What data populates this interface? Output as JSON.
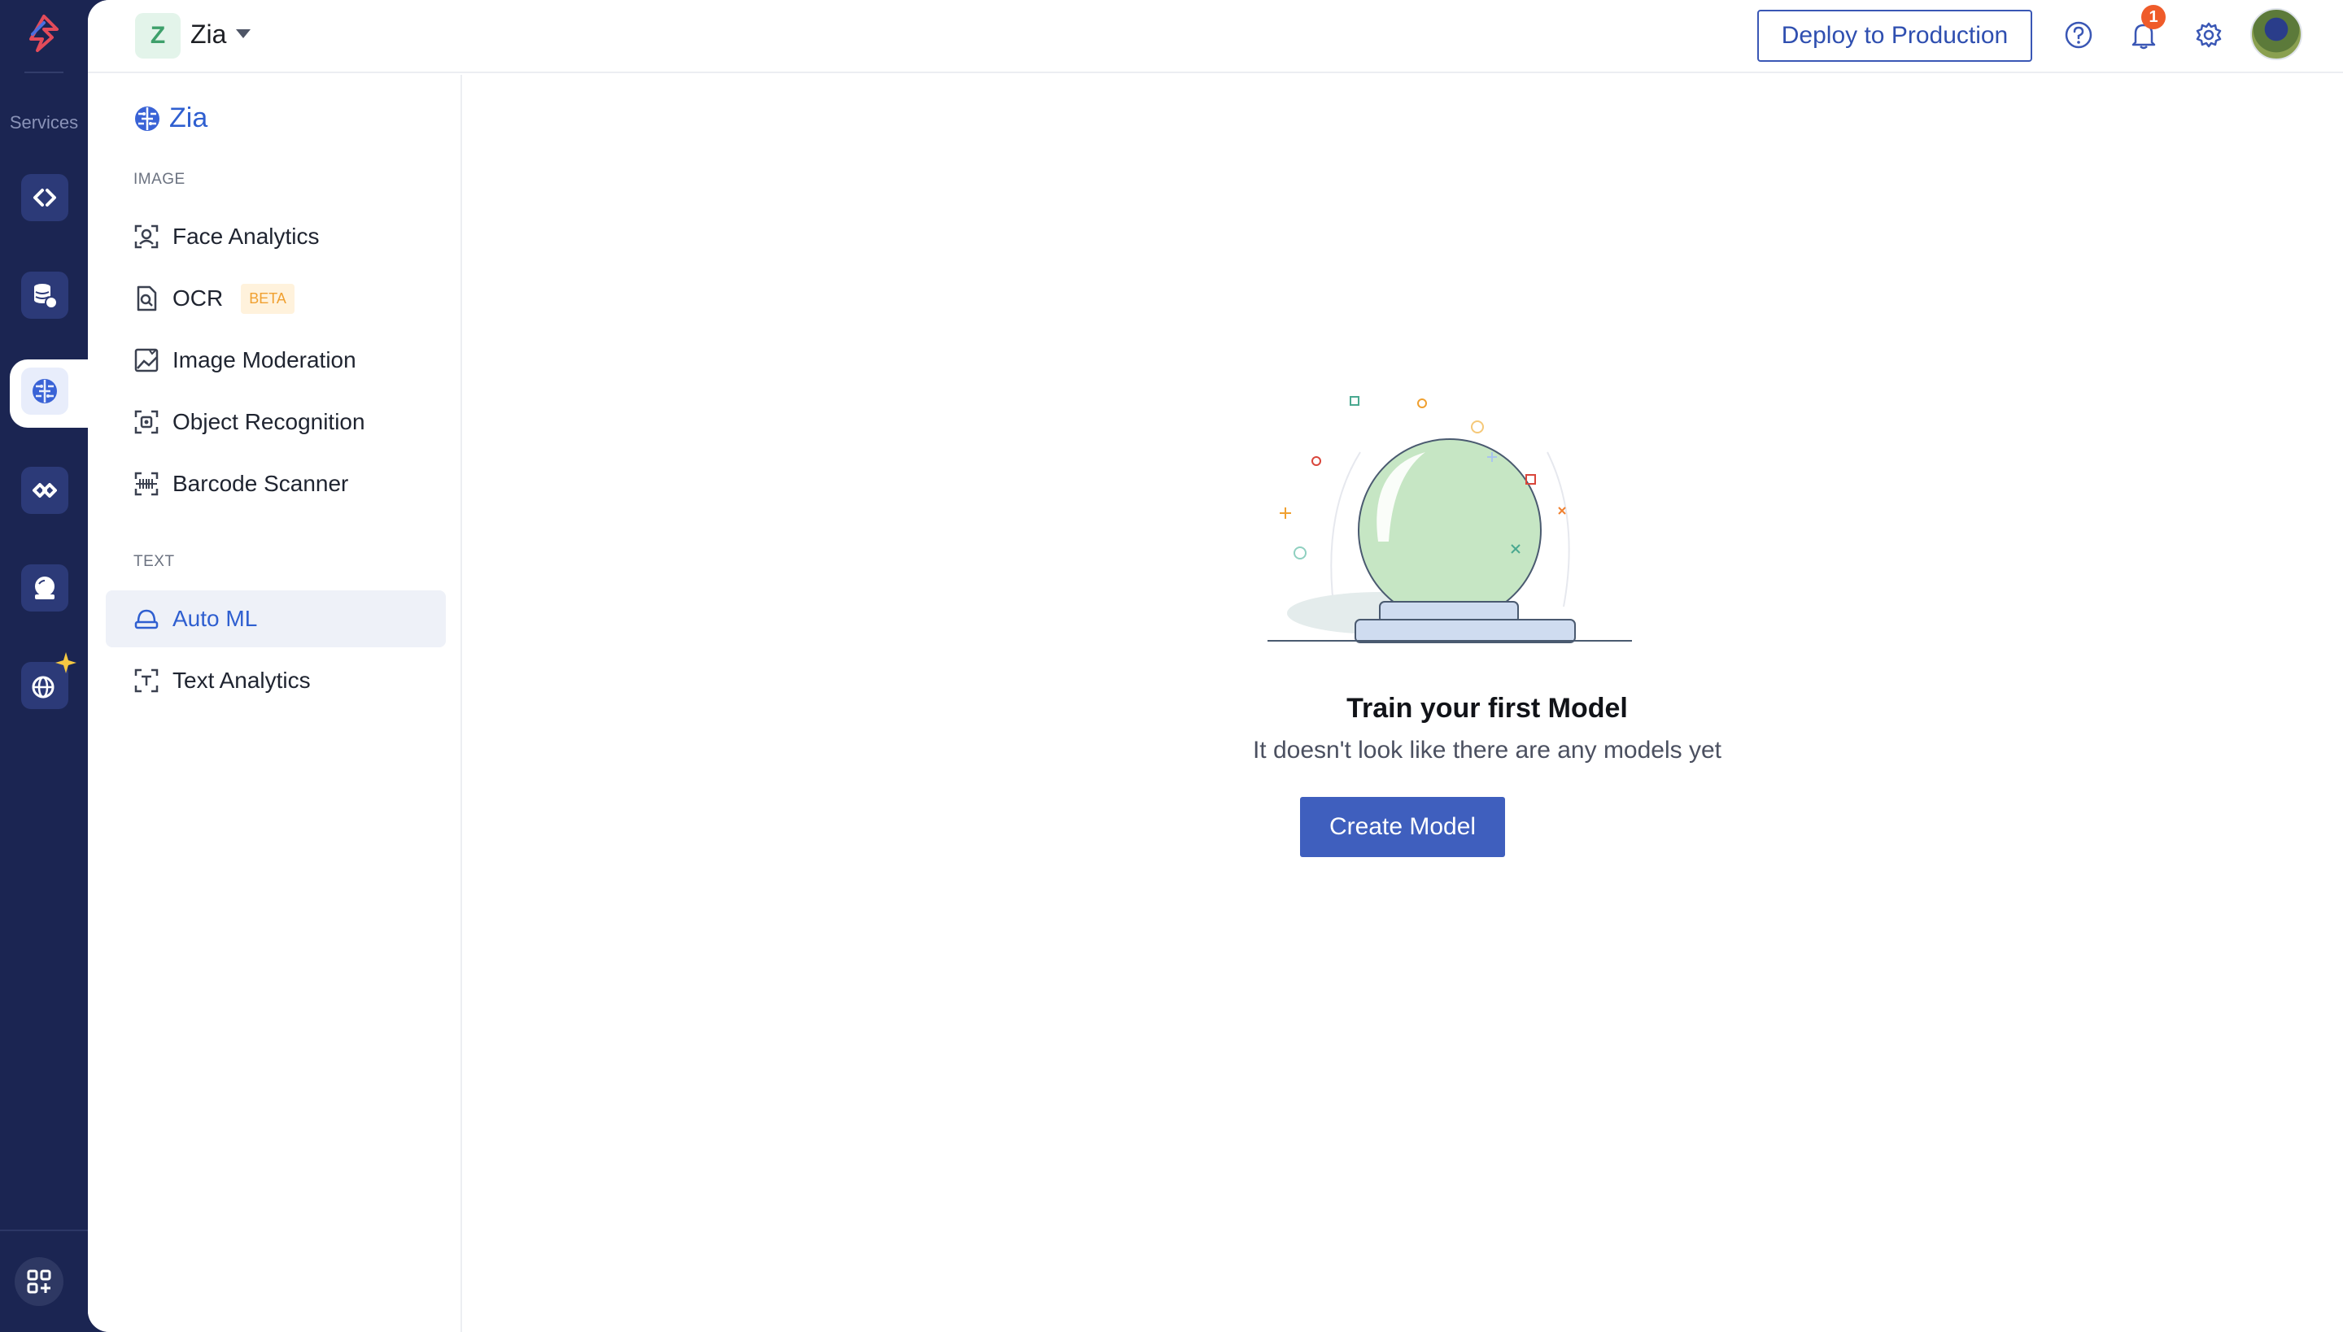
{
  "rail": {
    "services_label": "Services",
    "items": [
      {
        "icon": "code-icon"
      },
      {
        "icon": "database-cloud-icon"
      },
      {
        "icon": "brain-icon"
      },
      {
        "icon": "integration-icon"
      },
      {
        "icon": "bot-icon"
      },
      {
        "icon": "globe-sparkle-icon"
      }
    ],
    "bottom_icon": "apps-add-icon"
  },
  "header": {
    "project_initial": "Z",
    "project_name": "Zia",
    "deploy_label": "Deploy to Production",
    "notification_count": "1"
  },
  "sidebar": {
    "title": "Zia",
    "sections": [
      {
        "heading": "IMAGE",
        "items": [
          {
            "label": "Face Analytics",
            "icon": "face-scan-icon"
          },
          {
            "label": "OCR",
            "icon": "document-search-icon",
            "badge": "BETA"
          },
          {
            "label": "Image Moderation",
            "icon": "image-check-icon"
          },
          {
            "label": "Object Recognition",
            "icon": "object-scan-icon"
          },
          {
            "label": "Barcode Scanner",
            "icon": "barcode-icon"
          }
        ]
      },
      {
        "heading": "TEXT",
        "items": [
          {
            "label": "Auto ML",
            "icon": "automl-icon",
            "active": true
          },
          {
            "label": "Text Analytics",
            "icon": "text-scan-icon"
          }
        ]
      }
    ]
  },
  "empty_state": {
    "title": "Train your first Model",
    "subtitle": "It doesn't look like there are any models yet",
    "button_label": "Create Model",
    "illustration": "crystal-ball-illustration"
  },
  "colors": {
    "rail_bg": "#1b2552",
    "accent": "#3f5fbe",
    "active_text": "#2f5fd0",
    "badge_orange": "#ef5b2a"
  }
}
